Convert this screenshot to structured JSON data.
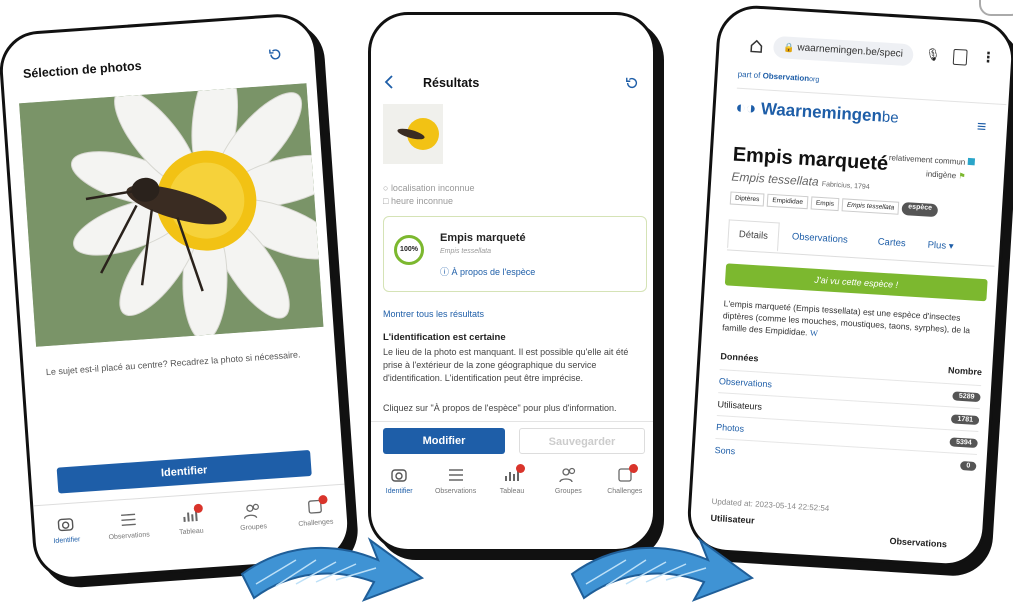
{
  "screen1": {
    "title": "Sélection de photos",
    "prompt": "Le sujet est-il placé au centre? Recadrez la photo si nécessaire.",
    "identify_button": "Identifier",
    "nav": [
      "Identifier",
      "Observations",
      "Tableau",
      "Groupes",
      "Challenges"
    ]
  },
  "screen2": {
    "title": "Résultats",
    "location": "localisation inconnue",
    "time": "heure inconnue",
    "match": {
      "percent": "100%",
      "name": "Empis marqueté",
      "latin": "Empis tessellata",
      "about": "À propos de l'espèce"
    },
    "show_all": "Montrer tous les résultats",
    "certain_heading": "L'identification est certaine",
    "certain_body": "Le lieu de la photo est manquant. Il est possible qu'elle ait été prise à l'extérieur de la zone géographique du service d'identification. L'identification peut être imprécise.",
    "hint": "Cliquez sur \"À propos de l'espèce\" pour plus d'information.",
    "modify_button": "Modifier",
    "save_button": "Sauvegarder",
    "nav": [
      "Identifier",
      "Observations",
      "Tableau",
      "Groupes",
      "Challenges"
    ]
  },
  "screen3": {
    "url": "waarnemingen.be/speci",
    "part_of": "part of",
    "observation_org": "Observation",
    "observation_org_suffix": "org",
    "brand": "Waarnemingen",
    "brand_suffix": "be",
    "species": "Empis marqueté",
    "status1": "relativement commun",
    "status2": "indigène",
    "latin": "Empis tessellata",
    "author": "Fabricius, 1794",
    "taxonomy": [
      "Diptères",
      "Empididae",
      "Empis",
      "Empis tessellata",
      "espèce"
    ],
    "tabs": [
      "Détails",
      "Observations",
      "Cartes",
      "Plus ▾"
    ],
    "seen_button": "J'ai vu cette espèce !",
    "description": "L'empis marqueté (Empis tessellata) est une espèce d'insectes diptères (comme les mouches, moustiques, taons, syrphes), de la famille des Empididae.",
    "wiki": "W",
    "table_header": [
      "Données",
      "Nombre"
    ],
    "rows": [
      {
        "label": "Observations",
        "value": "5289"
      },
      {
        "label": "Utilisateurs",
        "value": "1781"
      },
      {
        "label": "Photos",
        "value": "5394"
      },
      {
        "label": "Sons",
        "value": "0"
      }
    ],
    "updated": "Updated at: 2023-05-14 22:52:54",
    "footer_left": "Utilisateur",
    "footer_right": "Observations"
  },
  "colors": {
    "blue": "#1e5ea8",
    "green": "#7cb82f",
    "red": "#d9342b"
  }
}
